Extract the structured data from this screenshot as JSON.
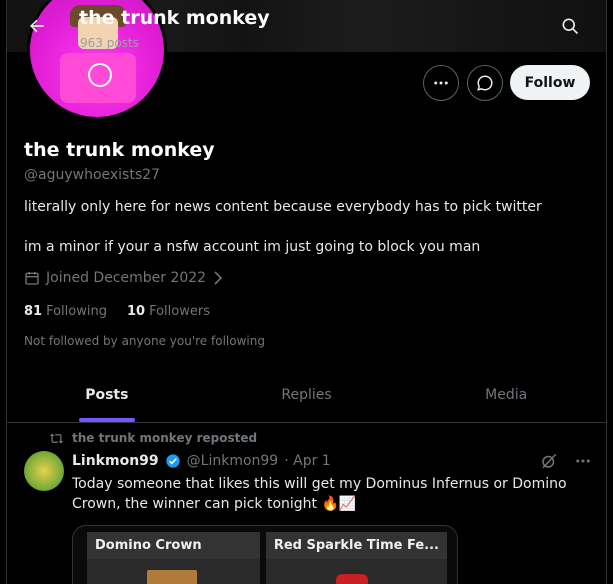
{
  "header": {
    "title": "the trunk monkey",
    "post_count": "963 posts"
  },
  "profile": {
    "name": "the trunk monkey",
    "handle": "@aguywhoexists27",
    "bio_line1": "literally only here for news content because everybody has to pick twitter",
    "bio_line2": "im a minor if your a nsfw account im just going to block you man",
    "joined": "Joined December 2022",
    "following_count": "81",
    "following_label": "Following",
    "followers_count": "10",
    "followers_label": "Followers",
    "not_followed": "Not followed by anyone you're following",
    "follow_label": "Follow"
  },
  "tabs": [
    {
      "label": "Posts",
      "active": true
    },
    {
      "label": "Replies",
      "active": false
    },
    {
      "label": "Media",
      "active": false
    }
  ],
  "tweet": {
    "repost_label": "the trunk monkey reposted",
    "author_name": "Linkmon99",
    "author_handle": "@Linkmon99",
    "date": "· Apr 1",
    "text": "Today someone that likes this will get my Dominus Infernus or Domino Crown, the winner can pick tonight 🔥📈",
    "cards": [
      {
        "title": "Domino Crown"
      },
      {
        "title": "Red Sparkle Time Fe..."
      }
    ]
  },
  "colors": {
    "accent": "#7856ff",
    "verified": "#1d9bf0",
    "muted": "#71767b"
  },
  "icons": [
    "arrow-left-icon",
    "search-icon",
    "more-icon",
    "message-icon",
    "calendar-icon",
    "chevron-right-icon",
    "repost-icon",
    "verified-icon",
    "grok-icon"
  ]
}
